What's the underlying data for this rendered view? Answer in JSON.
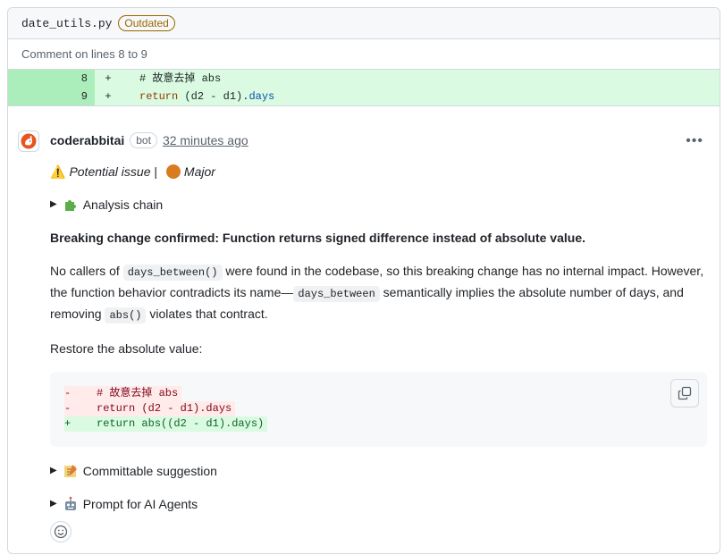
{
  "file": {
    "name": "date_utils.py",
    "badge": "Outdated"
  },
  "comment_lines": "Comment on lines 8 to 9",
  "diff": [
    {
      "num": "8",
      "sign": "+",
      "code": "# 故意去掉 abs"
    },
    {
      "num": "9",
      "sign": "+",
      "code_kw": "return",
      "code_mid": " (d2 - d1).",
      "code_attr": "days"
    }
  ],
  "comment": {
    "author": "coderabbitai",
    "bot_label": "bot",
    "time": "32 minutes ago",
    "issue_prefix": "Potential issue",
    "issue_sep": " | ",
    "issue_severity": "Major",
    "analysis_chain": "Analysis chain",
    "headline": "Breaking change confirmed: Function returns signed difference instead of absolute value.",
    "para1_a": "No callers of ",
    "para1_code1": "days_between()",
    "para1_b": " were found in the codebase, so this breaking change has no internal impact. However, the function behavior contradicts its name—",
    "para1_code2": "days_between",
    "para1_c": " semantically implies the absolute number of days, and removing ",
    "para1_code3": "abs()",
    "para1_d": " violates that contract.",
    "restore": "Restore the absolute value:",
    "suggestion_lines": [
      {
        "type": "del",
        "text": "-    # 故意去掉 abs"
      },
      {
        "type": "del",
        "text": "-    return (d2 - d1).days"
      },
      {
        "type": "add",
        "text": "+    return abs((d2 - d1).days)"
      }
    ],
    "committable": "Committable suggestion",
    "prompt": "Prompt for AI Agents"
  },
  "icons": {
    "copy": "copy-icon",
    "kebab": "kebab-menu-icon",
    "smiley": "smiley-icon",
    "warning": "warning-icon"
  },
  "colors": {
    "added_bg": "#dafbe1",
    "added_num_bg": "#aceebb",
    "outdated": "#9a6700",
    "deleted_text": "#82071e"
  }
}
